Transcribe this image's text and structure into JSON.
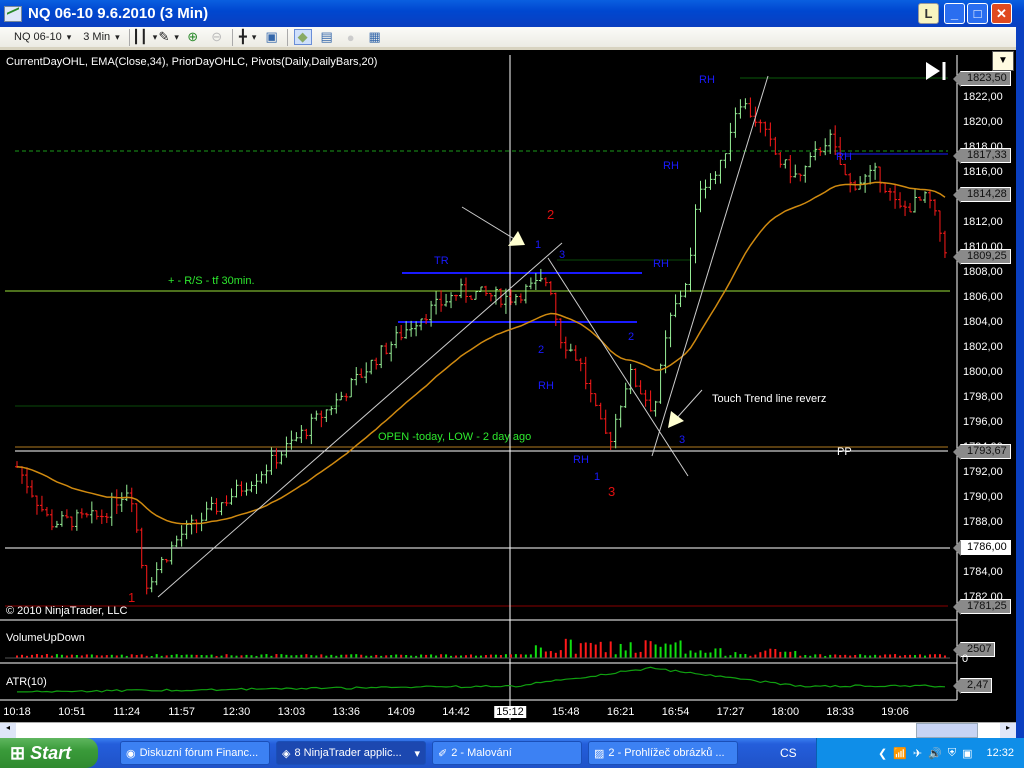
{
  "window": {
    "title": "NQ 06-10  9.6.2010 (3 Min)",
    "buttons": [
      "L",
      "_",
      "□",
      "✕"
    ]
  },
  "toolbar": {
    "instrument": "NQ 06-10",
    "interval": "3 Min",
    "icons": [
      "bar-style-icon",
      "pencil-icon",
      "zoom-in-icon",
      "zoom-out-icon",
      "crosshair-icon",
      "properties-icon",
      "data-box-icon",
      "chart-trader-icon",
      "record-icon",
      "table-icon"
    ]
  },
  "indicators_label": "CurrentDayOHL, EMA(Close,34), PriorDayOHLC, Pivots(Daily,DailyBars,20)",
  "copyright": "© 2010 NinjaTrader, LLC",
  "annotations": {
    "rs": "+ - R/S - tf 30min.",
    "open": "OPEN -today, LOW - 2 day ago",
    "touch": "Touch Trend line reverz",
    "tr": "TR",
    "rh": "RH",
    "pp": "PP",
    "n1": "1",
    "n2": "2",
    "n3": "3"
  },
  "panels": {
    "volume": "VolumeUpDown",
    "atr": "ATR(10)",
    "volume_value": "2507",
    "volume_zero": "0",
    "atr_value": "2,47"
  },
  "colors": {
    "up": "#98f098",
    "down": "#ff1a1a",
    "ema": "#d08a10",
    "blue": "#1a1aff"
  },
  "chart_data": {
    "type": "bar",
    "title": "NQ 06-10 3 Min",
    "y_ticks": [
      "1822,00",
      "1820,00",
      "1818,00",
      "1816,00",
      "1814,00",
      "1812,00",
      "1810,00",
      "1808,00",
      "1806,00",
      "1804,00",
      "1802,00",
      "1800,00",
      "1798,00",
      "1796,00",
      "1794,00",
      "1792,00",
      "1790,00",
      "1788,00",
      "1786,00",
      "1784,00",
      "1782,00"
    ],
    "y_tick_values": [
      1822,
      1820,
      1818,
      1816,
      1814,
      1812,
      1810,
      1808,
      1806,
      1804,
      1802,
      1800,
      1798,
      1796,
      1794,
      1792,
      1790,
      1788,
      1786,
      1784,
      1782
    ],
    "x_ticks": [
      "10:18",
      "10:51",
      "11:24",
      "11:57",
      "12:30",
      "13:03",
      "13:36",
      "14:09",
      "14:42",
      "15:48",
      "16:21",
      "16:54",
      "17:27",
      "18:00",
      "18:33",
      "19:06"
    ],
    "cursor_time": "15:12",
    "price_tags": [
      {
        "label": "1823,50",
        "value": 1823.5
      },
      {
        "label": "1817,33",
        "value": 1817.33
      },
      {
        "label": "1814,28",
        "value": 1814.28
      },
      {
        "label": "1809,25",
        "value": 1809.25
      },
      {
        "label": "1793,67",
        "value": 1793.67
      },
      {
        "label": "1786,00",
        "value": 1786
      },
      {
        "label": "1781,25",
        "value": 1781.25
      }
    ],
    "close_path": [
      [
        "10:18",
        1792.5
      ],
      [
        "10:38",
        1788
      ],
      [
        "11:08",
        1788.5
      ],
      [
        "11:26",
        1791
      ],
      [
        "11:35",
        1783
      ],
      [
        "11:56",
        1787
      ],
      [
        "12:20",
        1789.5
      ],
      [
        "12:44",
        1792
      ],
      [
        "13:08",
        1795
      ],
      [
        "13:32",
        1798
      ],
      [
        "13:56",
        1801.5
      ],
      [
        "14:20",
        1804.5
      ],
      [
        "14:44",
        1806.5
      ],
      [
        "15:14",
        1806
      ],
      [
        "15:38",
        1807.5
      ],
      [
        "15:44",
        1803
      ],
      [
        "15:56",
        1801
      ],
      [
        "16:08",
        1796
      ],
      [
        "16:14",
        1794.5
      ],
      [
        "16:26",
        1800
      ],
      [
        "16:41",
        1797
      ],
      [
        "16:50",
        1804
      ],
      [
        "17:02",
        1808
      ],
      [
        "17:08",
        1815
      ],
      [
        "17:20",
        1816
      ],
      [
        "17:32",
        1822
      ],
      [
        "17:44",
        1820
      ],
      [
        "17:56",
        1817
      ],
      [
        "18:08",
        1815.5
      ],
      [
        "18:26",
        1819
      ],
      [
        "18:38",
        1815
      ],
      [
        "18:56",
        1816
      ],
      [
        "19:08",
        1813
      ],
      [
        "19:26",
        1814
      ],
      [
        "19:38",
        1809.25
      ]
    ],
    "ema_period": 34,
    "ylim": [
      1781,
      1825
    ]
  }
}
